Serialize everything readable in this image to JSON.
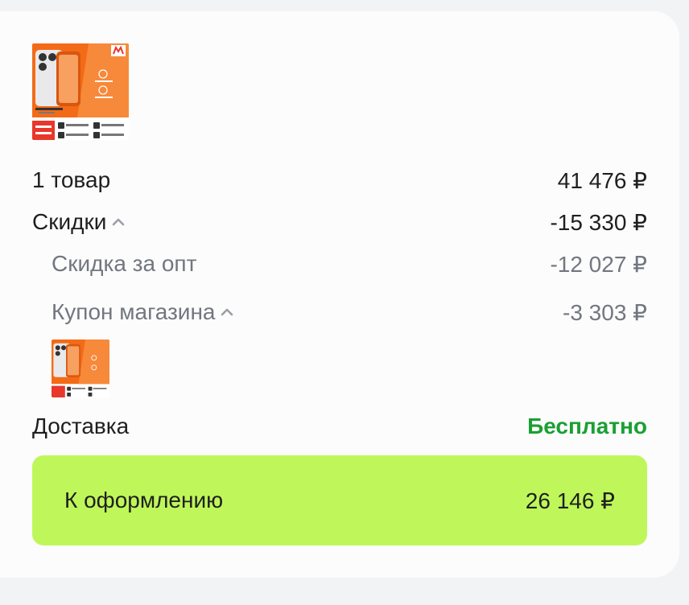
{
  "product": {
    "image_alt": "realme 15 Pro",
    "badge": "GLOBAL VERSION",
    "brand_logo_icon": "megamarket-logo-icon"
  },
  "summary": {
    "items_label": "1 товар",
    "items_value": "41 476 ₽",
    "discounts_label": "Скидки",
    "discounts_value": "-15 330 ₽",
    "wholesale_label": "Скидка за опт",
    "wholesale_value": "-12 027 ₽",
    "coupon_label": "Купон магазина",
    "coupon_value": "-3 303 ₽",
    "delivery_label": "Доставка",
    "delivery_value": "Бесплатно"
  },
  "checkout": {
    "label": "К оформлению",
    "value": "26 146 ₽"
  },
  "colors": {
    "accent": "#bff75a",
    "free": "#1aa032",
    "muted": "#72767f",
    "product_orange": "#f36b17"
  }
}
